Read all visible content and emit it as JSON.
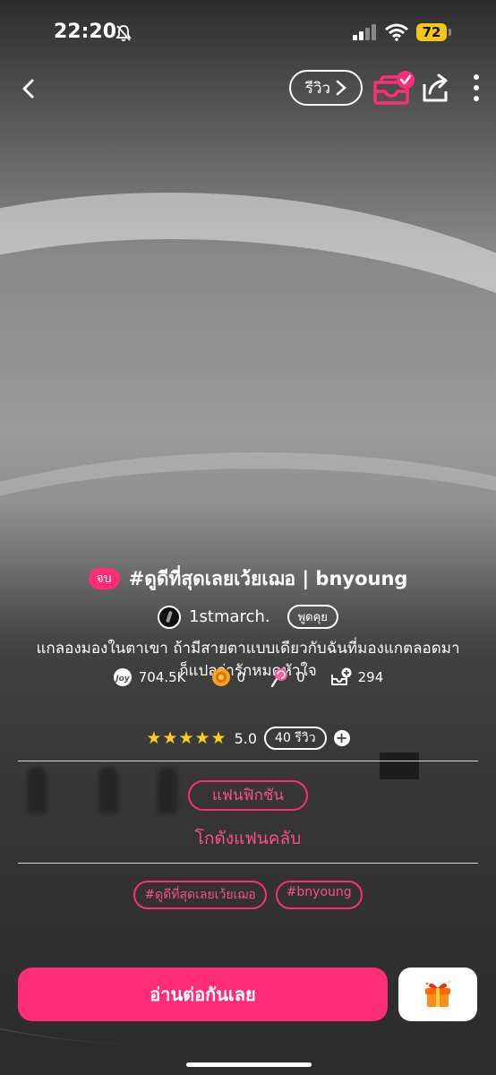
{
  "status_bar": {
    "time": "22:20",
    "battery": "72"
  },
  "topbar": {
    "review_label": "รีวิว"
  },
  "story": {
    "status_badge": "จบ",
    "title": "#ดูดีที่สุดเลยเว้ยเฌอ | bnyoung",
    "author": "1stmarch.",
    "chat_label": "พูดคุย",
    "synopsis_line1": "แกลองมองในตาเขา ถ้ามีสายตาแบบเดียวกับฉันที่มองแกตลอดมา",
    "synopsis_line2": "ก็แปลว่ารักหมดหัวใจ"
  },
  "stats": {
    "views": "704.5K",
    "coins": "0",
    "candies": "0",
    "library": "294"
  },
  "rating": {
    "stars": "★★★★★",
    "score": "5.0",
    "reviews": "40 รีวิว"
  },
  "genre": "แฟนฟิกชัน",
  "fanclub": "โกดังแฟนคลับ",
  "tags": [
    "#ดูดีที่สุดเลยเว้ยเฌอ",
    "#bnyoung"
  ],
  "actions": {
    "read": "อ่านต่อกันเลย"
  },
  "colors": {
    "accent": "#ff2d78",
    "star": "#ffcc1a",
    "battery": "#f5c518"
  }
}
